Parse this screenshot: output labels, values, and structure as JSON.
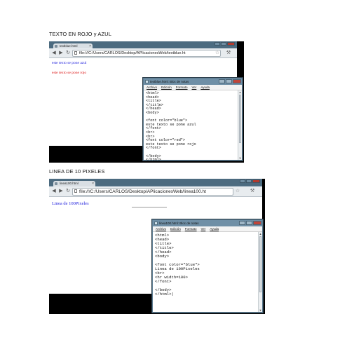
{
  "section1": {
    "caption": "TEXTO EN ROJO y AZUL",
    "browser": {
      "tab_title": "textblue.html",
      "tab_close": "×",
      "url": "file:///C:/Users/CARLOS/Desktop/APlicacionesWeb/textblue.ht",
      "page_lines": [
        {
          "text": "este texto se pone azul",
          "color": "#1a1adc"
        },
        {
          "text": "este texto se pone rojo",
          "color": "#dc1a1a"
        }
      ]
    },
    "notepad": {
      "title": "textblue.html: Bloc de notas",
      "menu": [
        "Archivo",
        "Edición",
        "Formato",
        "Ver",
        "Ayuda"
      ],
      "content": "<html>\n<head>\n<title>\n</title>\n</head>\n<body>\n\n<font color=\"blue\">\neste texto se pone azul\n</font>\n<br>\n<br>\n<font color=\"red\">\neste texto se pone rojo\n</font>\n\n</body>\n</html>"
    }
  },
  "section2": {
    "caption": "LINEA DE 10 PIXELES",
    "browser": {
      "tab_title": "linea100.html",
      "tab_close": "×",
      "url": "file:///C:/Users/CARLOS/Desktop/APlicacionesWeb/linea100.ht",
      "page_lines": [
        {
          "text": "Linea de 100Pixeles",
          "color": "#1a1adc"
        }
      ]
    },
    "notepad": {
      "title": "linea100.html: Bloc de notas",
      "menu": [
        "Archivo",
        "Edición",
        "Formato",
        "Ver",
        "Ayuda"
      ],
      "content": "<html>\n<head>\n<title>\n</title>\n</head>\n<body>\n\n<font color=\"blue\">\nLinea de 100Pixeles\n<br>\n<hr width=100>\n</font>\n\n</body>\n</html>|"
    }
  },
  "icons": {
    "back": "back-arrow-icon",
    "forward": "forward-arrow-icon",
    "reload": "reload-icon",
    "star": "star-icon",
    "wrench": "wrench-icon"
  }
}
